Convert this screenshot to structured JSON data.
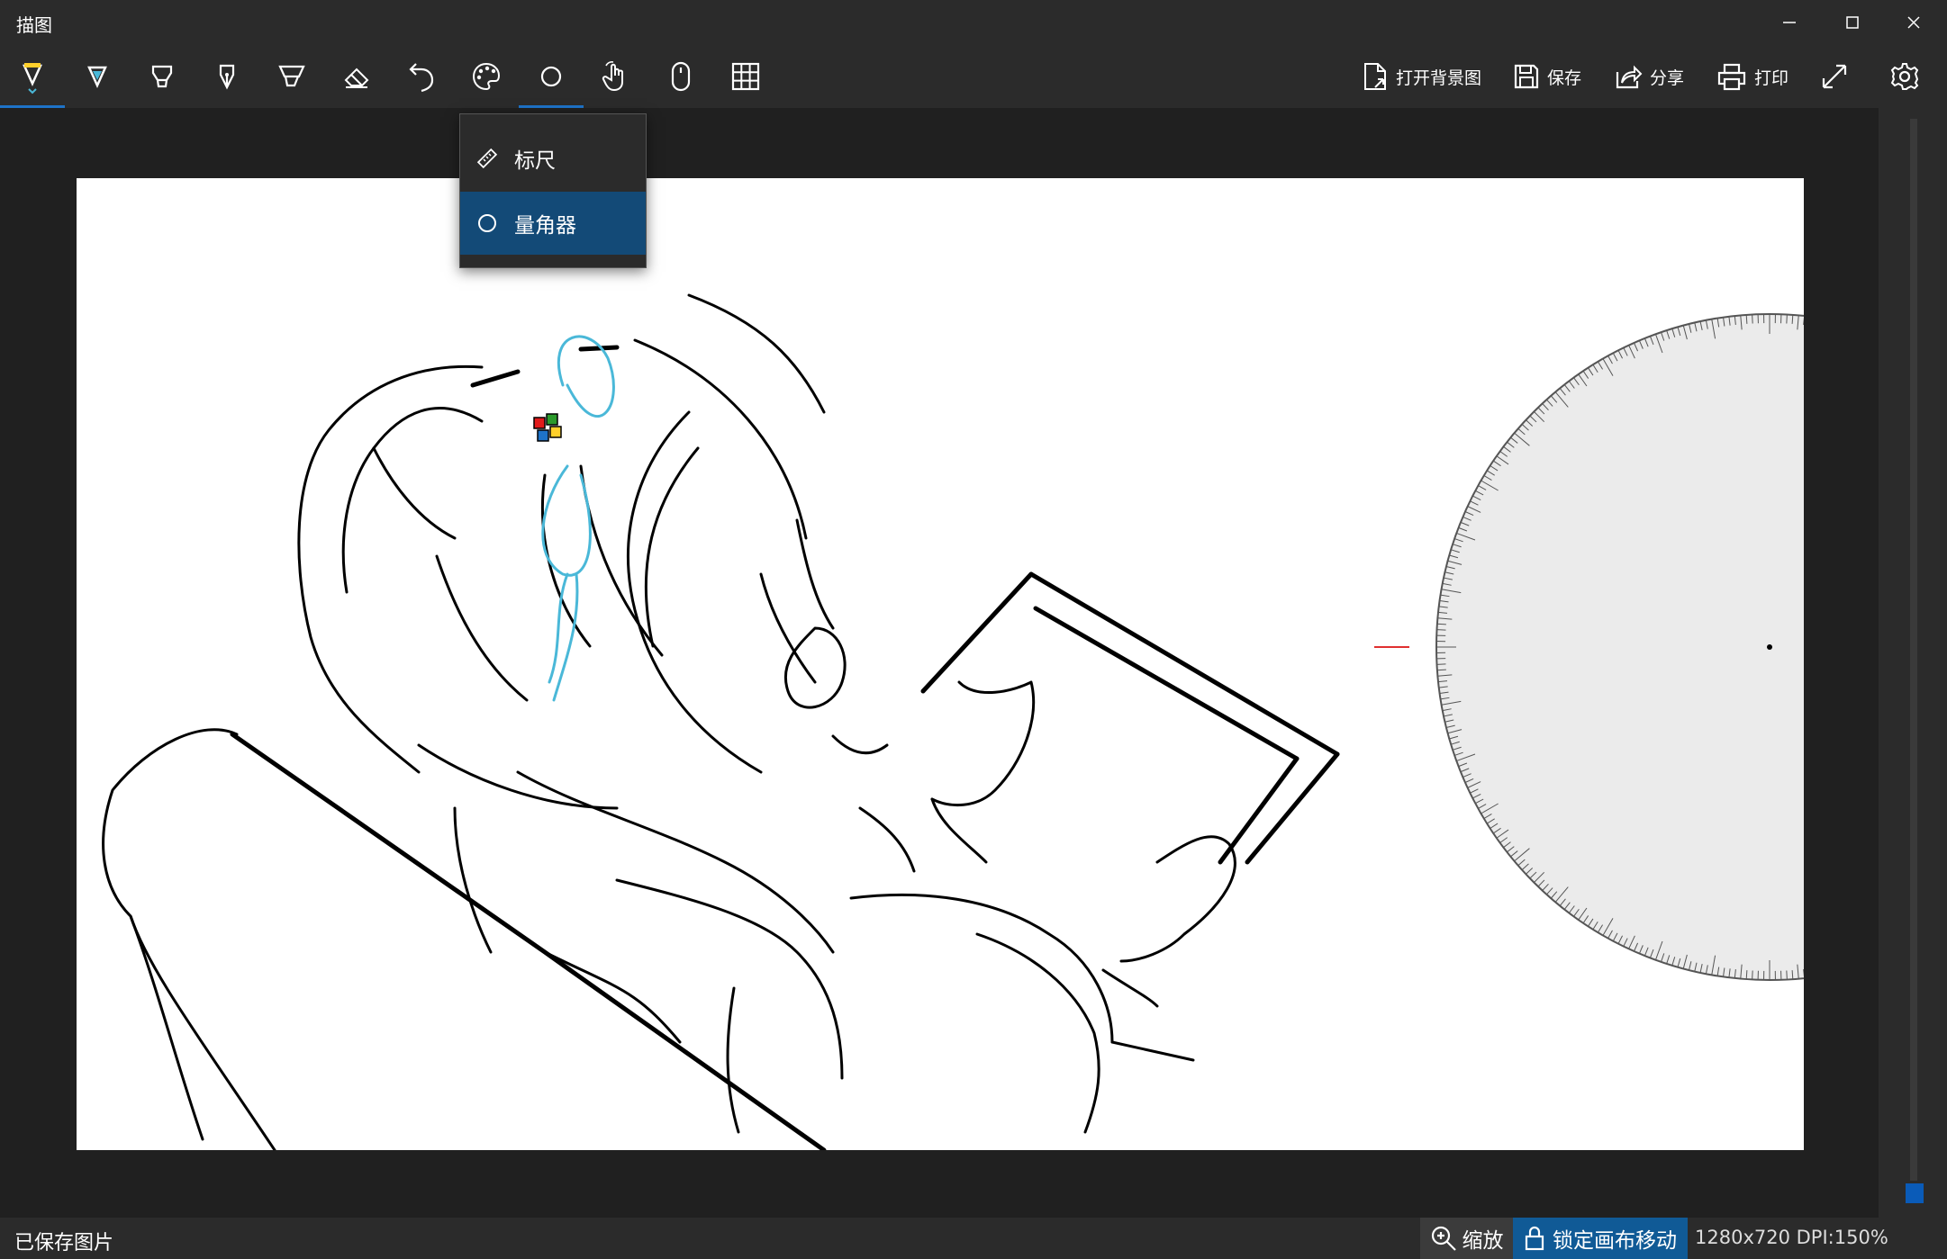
{
  "app": {
    "title": "描图"
  },
  "toolbar": {
    "actions": {
      "open_background": "打开背景图",
      "save": "保存",
      "share": "分享",
      "print": "打印"
    }
  },
  "menu": {
    "items": [
      {
        "label": "标尺",
        "icon": "ruler-icon",
        "active": false
      },
      {
        "label": "量角器",
        "icon": "protractor-icon",
        "active": true
      }
    ]
  },
  "status": {
    "message": "已保存图片",
    "zoom_label": "缩放",
    "lock_label": "锁定画布移动",
    "dimensions": "1280x720 DPI:150%"
  },
  "colors": {
    "accent": "#1e73c8",
    "menu_active": "#134a77",
    "lock_active": "#105a96",
    "ribbon": "#4ab8d8",
    "protractor_fill": "#ebebeb",
    "zero_mark": "#e03030"
  }
}
